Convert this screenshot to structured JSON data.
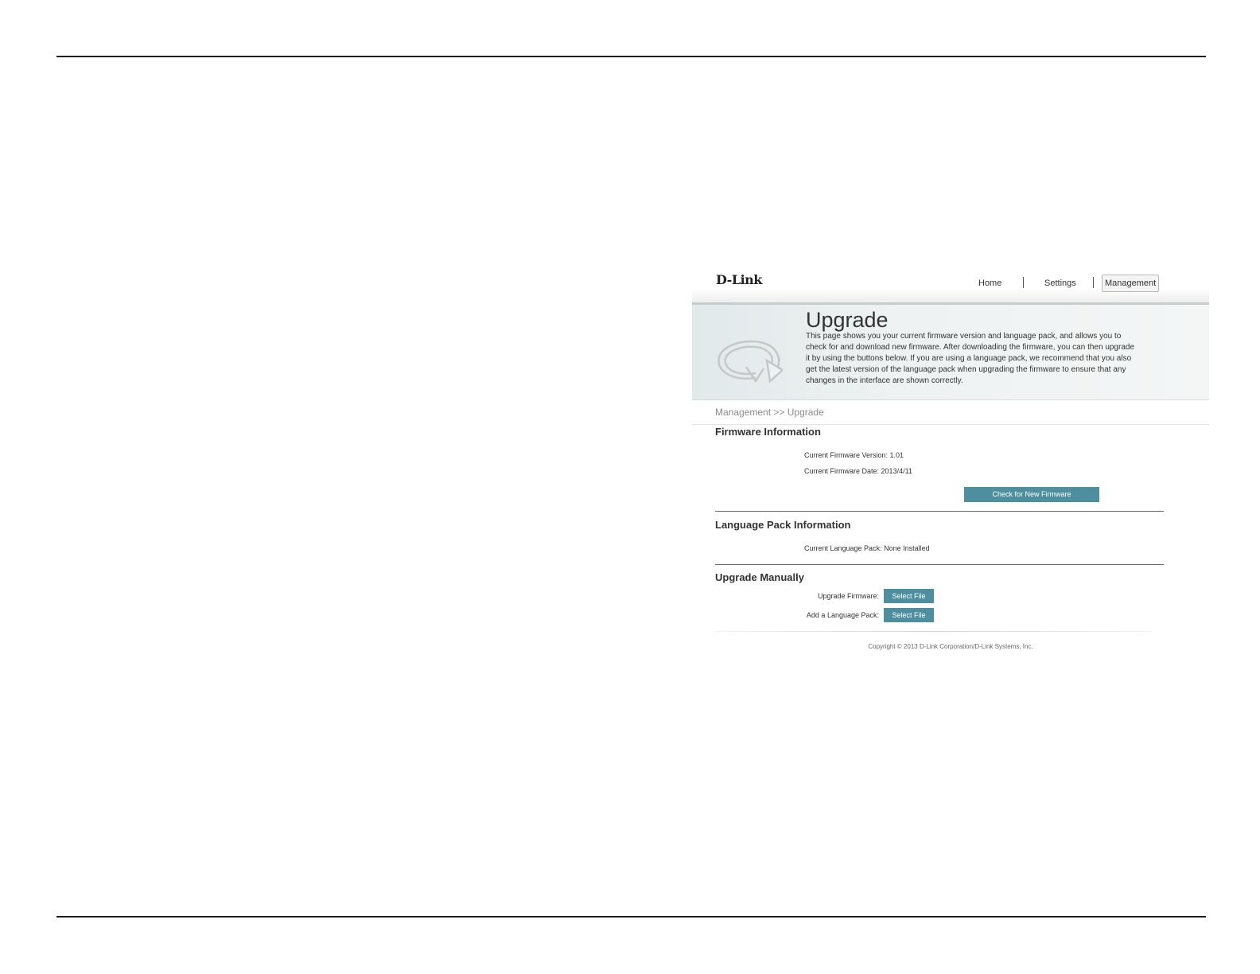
{
  "header": {
    "logo": "D-Link",
    "nav": [
      {
        "label": "Home"
      },
      {
        "label": "Settings"
      },
      {
        "label": "Management"
      }
    ]
  },
  "hero": {
    "icon": "refresh-arrow-icon",
    "title": "Upgrade",
    "description": "This page shows you your current firmware version and language pack, and allows you to check for and download new firmware. After downloading the firmware, you can then upgrade it by using the buttons below. If you are using a language pack, we recommend that you also get the latest version of the language pack when upgrading the firmware to ensure that any changes in the interface are shown correctly."
  },
  "breadcrumb": "Management >> Upgrade",
  "firmware": {
    "title": "Firmware Information",
    "version_label": "Current Firmware Version:",
    "version_value": "1.01",
    "date_label": "Current Firmware Date:",
    "date_value": "2013/4/11",
    "check_button": "Check for New Firmware"
  },
  "language": {
    "title": "Language Pack Information",
    "current_label": "Current Language Pack:",
    "current_value": "None Installed"
  },
  "manual": {
    "title": "Upgrade Manually",
    "firmware_label": "Upgrade Firmware:",
    "firmware_button": "Select File",
    "langpack_label": "Add a Language Pack:",
    "langpack_button": "Select File"
  },
  "footer": "Copyright © 2013 D-Link Corporation/D-Link Systems, Inc.",
  "colors": {
    "accent_button": "#4d8f9e",
    "hero_bg": "#e8eeee"
  }
}
